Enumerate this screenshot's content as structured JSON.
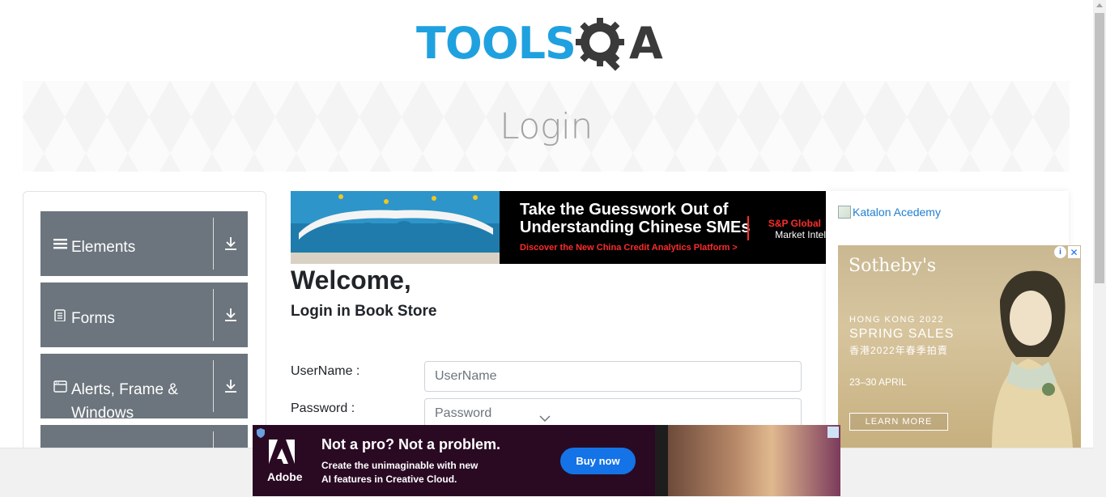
{
  "brand": {
    "logo_left": "TOOLS",
    "logo_right": "A",
    "logo_colors": {
      "blue": "#1fa1e0",
      "dark": "#3a3a3a"
    }
  },
  "header": {
    "title": "Login"
  },
  "sidebar": {
    "groups": [
      {
        "label": "Elements",
        "icon": "hamburger-menu-icon"
      },
      {
        "label": "Forms",
        "icon": "document-icon"
      },
      {
        "label": "Alerts, Frame & Windows",
        "icon": "browser-window-icon"
      },
      {
        "label": "",
        "icon": ""
      }
    ],
    "group_color": "#6c757d"
  },
  "ads": {
    "top": {
      "headline_line1": "Take the Guesswork Out of",
      "headline_line2": "Understanding Chinese SMEs",
      "subline": "Discover the New China Credit Analytics Platform >",
      "brand_line1": "S&P Global",
      "brand_line2": "Market Intel"
    },
    "side_link": "Katalon Acedemy",
    "side": {
      "brand": "Sotheby's",
      "year_line": "HONG KONG 2022",
      "title": "SPRING SALES",
      "chinese": "香港2022年春季拍賣",
      "dates": "23–30 APRIL",
      "cta": "LEARN MORE"
    },
    "bottom": {
      "brand": "Adobe",
      "headline": "Not a pro? Not a problem.",
      "sub_line1": "Create the unimaginable with new",
      "sub_line2": "AI features in Creative Cloud.",
      "button": "Buy now"
    }
  },
  "main": {
    "welcome": "Welcome,",
    "subtitle": "Login in Book Store",
    "username_label": "UserName :",
    "username_placeholder": "UserName",
    "password_label": "Password :",
    "password_placeholder": "Password"
  }
}
